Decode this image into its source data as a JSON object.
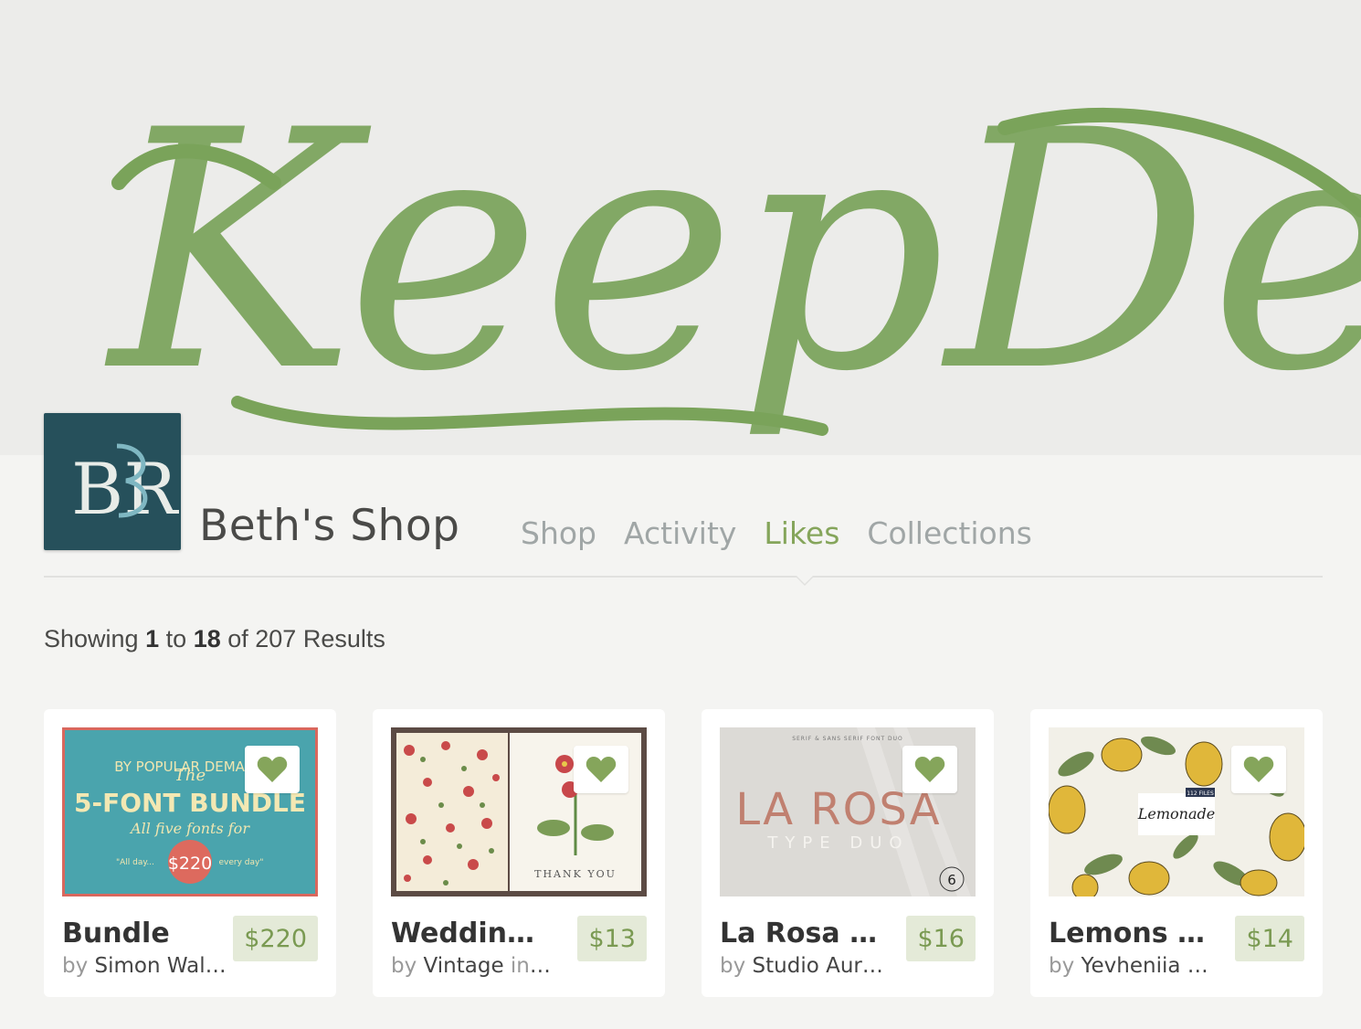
{
  "banner": {
    "art_text": "KeepDesign",
    "color": "#7aa35a"
  },
  "shop": {
    "name": "Beth's Shop",
    "avatar_monogram": "BR",
    "avatar_color": "#26505b"
  },
  "nav": {
    "items": [
      {
        "label": "Shop",
        "active": false
      },
      {
        "label": "Activity",
        "active": false
      },
      {
        "label": "Likes",
        "active": true
      },
      {
        "label": "Collections",
        "active": false
      }
    ]
  },
  "results": {
    "prefix": "Showing",
    "from": "1",
    "to_word": "to",
    "to": "18",
    "of_text": "of 207 Results"
  },
  "products": [
    {
      "title": "Bundle",
      "by_word": "by",
      "author": "Simon Wal…",
      "in_text": "",
      "price": "$220",
      "liked": true,
      "icon": "heart-icon"
    },
    {
      "title": "Wedding …",
      "by_word": "by",
      "author": "Vintage",
      "in_text": "in …",
      "price": "$13",
      "liked": true,
      "icon": "heart-icon"
    },
    {
      "title": "La Rosa – …",
      "by_word": "by",
      "author": "Studio Aur…",
      "in_text": "",
      "price": "$16",
      "liked": true,
      "icon": "heart-icon"
    },
    {
      "title": "Lemons - …",
      "by_word": "by",
      "author": "Yevheniia i…",
      "in_text": "",
      "price": "$14",
      "liked": true,
      "icon": "heart-icon"
    }
  ],
  "thumbs": {
    "bundle": {
      "arc": "BY POPULAR DEMAND",
      "the": "The",
      "headline": "5-FONT BUNDLE",
      "sub": "All five fonts for",
      "left": "\"All day...",
      "price": "$220",
      "right": "every day\""
    },
    "wedding": {
      "caption": "THANK YOU"
    },
    "larosa": {
      "top": "SERIF & SANS SERIF FONT DUO",
      "name": "LA ROSA",
      "sub": "TYPE DUO",
      "badge": "6"
    },
    "lemons": {
      "tag": "112 FILES",
      "name": "Lemonade"
    }
  },
  "colors": {
    "accent": "#85a55b",
    "price_bg": "#e4ead8"
  }
}
